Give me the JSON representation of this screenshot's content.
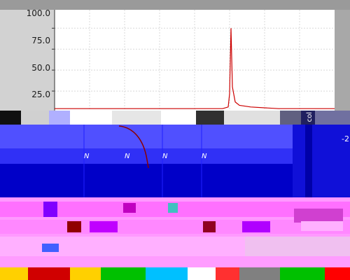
{
  "chart_data": {
    "type": "line",
    "title": "",
    "xlabel": "",
    "ylabel": "",
    "y_tick_labels": [
      "100.0",
      "75.0",
      "50.0",
      "25.0"
    ],
    "y_ticks": [
      100,
      75,
      50,
      25
    ],
    "ylim": [
      0,
      100
    ],
    "xlim": [
      0,
      1
    ],
    "grid": true,
    "series": [
      {
        "color": "#cc0000",
        "x": [
          0.0,
          0.25,
          0.5,
          0.6,
          0.62,
          0.625,
          0.63,
          0.635,
          0.645,
          0.66,
          0.7,
          0.8,
          1.0
        ],
        "y": [
          4,
          4,
          4,
          4,
          6,
          22,
          100,
          30,
          12,
          8,
          6,
          4,
          4
        ]
      }
    ]
  },
  "panels": {
    "side_label": "col",
    "side_number": "-2",
    "cell_labels": [
      "N",
      "N",
      "N",
      "N"
    ]
  },
  "colors": {
    "plot_background": "#ffffff",
    "grid": "#d8d8d8",
    "line": "#cc0000",
    "blue_panel": "#0a0ae6",
    "pink_panel": "#ff99ff",
    "bottom_strip": "#ffd700"
  }
}
